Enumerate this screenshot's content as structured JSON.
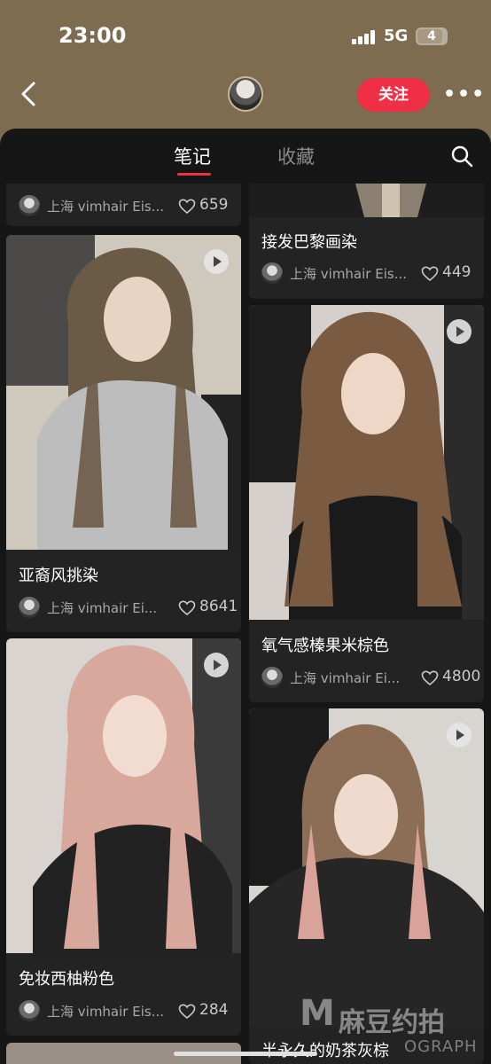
{
  "status_bar": {
    "time": "23:00",
    "network": "5G",
    "battery": "4"
  },
  "header": {
    "follow_label": "关注",
    "more_label": "•••"
  },
  "tabs": [
    {
      "label": "笔记",
      "active": true
    },
    {
      "label": "收藏",
      "active": false
    }
  ],
  "colors": {
    "accent": "#ee2f46",
    "panel": "#161616",
    "card": "#232323",
    "header_bg": "#7d6c50"
  },
  "left_column": [
    {
      "title": "",
      "author": "上海 vimhair Eis...",
      "likes": "659",
      "video": false
    },
    {
      "title": "亚裔风挑染",
      "author": "上海 vimhair Ei...",
      "likes": "8641",
      "video": true
    },
    {
      "title": "免妆西柚粉色",
      "author": "上海 vimhair Eis...",
      "likes": "284",
      "video": true
    }
  ],
  "right_column": [
    {
      "title": "接发巴黎画染",
      "author": "上海 vimhair Eis...",
      "likes": "449",
      "video": false
    },
    {
      "title": "氧气感榛果米棕色",
      "author": "上海 vimhair Ei...",
      "likes": "4800",
      "video": true
    },
    {
      "title": "半永久的奶茶灰棕",
      "author": "",
      "likes": "",
      "video": true
    }
  ],
  "watermark": {
    "logo": "M",
    "text": "麻豆约拍",
    "sub": "OGRAPH"
  }
}
